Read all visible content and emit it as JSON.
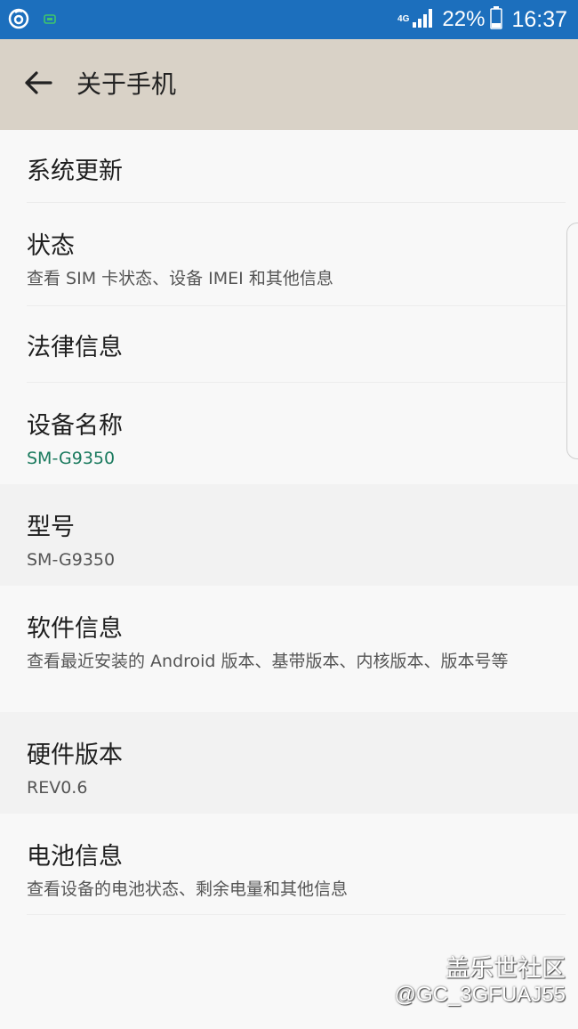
{
  "status_bar": {
    "network_label": "4G",
    "battery_percent": "22%",
    "clock": "16:37",
    "icons": [
      "music-app-icon",
      "screen-notification-icon",
      "signal-icon",
      "battery-icon"
    ]
  },
  "app_bar": {
    "back_icon": "arrow-left-icon",
    "title": "关于手机",
    "background": "#d9d2c7"
  },
  "settings": {
    "items": [
      {
        "title": "系统更新"
      },
      {
        "title": "状态",
        "subtitle": "查看 SIM 卡状态、设备 IMEI 和其他信息"
      },
      {
        "title": "法律信息"
      },
      {
        "title": "设备名称",
        "subtitle": "SM-G9350",
        "subtitle_color": "#1a7a5e"
      },
      {
        "title": "型号",
        "subtitle": "SM-G9350"
      },
      {
        "title": "软件信息",
        "subtitle": "查看最近安装的 Android 版本、基带版本、内核版本、版本号等"
      },
      {
        "title": "硬件版本",
        "subtitle": "REV0.6"
      },
      {
        "title": "电池信息",
        "subtitle": "查看设备的电池状态、剩余电量和其他信息"
      }
    ]
  },
  "watermark": {
    "community": "盖乐世社区",
    "user": "@GC_3GFUAJ55"
  },
  "colors": {
    "status_bar": "#1c6fbd",
    "list_background": "#f8f8f8",
    "readonly_row": "#f2f2f2"
  }
}
